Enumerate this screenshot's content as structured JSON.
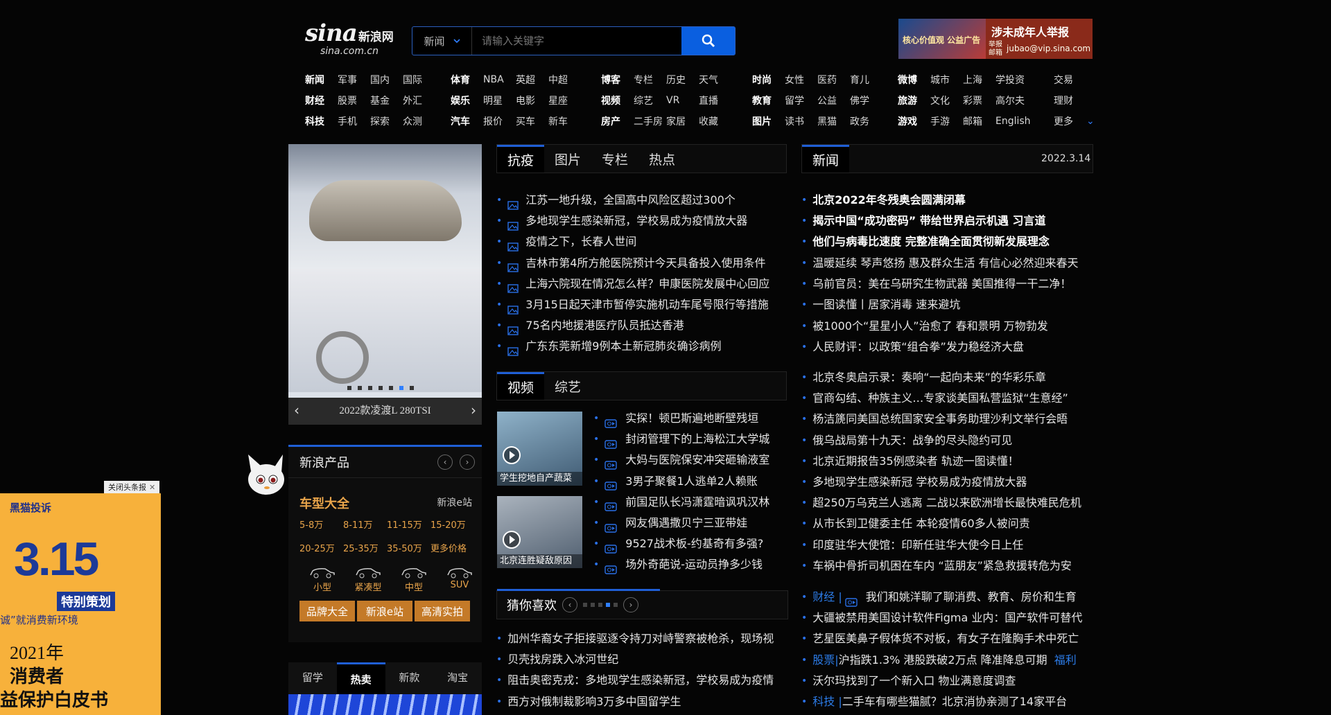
{
  "header": {
    "logo_text": "sina",
    "logo_cn": "新浪网",
    "logo_domain": "sina.com.cn",
    "search": {
      "category": "新闻",
      "placeholder": "请输入关键字"
    },
    "ad_left_text": "核心价值观 公益广告",
    "ad_right_title": "涉未成年人举报",
    "ad_right_side": "举报邮箱",
    "ad_right_email": "jubao@vip.sina.com"
  },
  "nav": {
    "groups": [
      {
        "rows": [
          [
            "新闻",
            "军事",
            "国内",
            "国际"
          ],
          [
            "财经",
            "股票",
            "基金",
            "外汇"
          ],
          [
            "科技",
            "手机",
            "探索",
            "众测"
          ]
        ]
      },
      {
        "rows": [
          [
            "体育",
            "NBA",
            "英超",
            "中超"
          ],
          [
            "娱乐",
            "明星",
            "电影",
            "星座"
          ],
          [
            "汽车",
            "报价",
            "买车",
            "新车"
          ]
        ]
      },
      {
        "rows": [
          [
            "博客",
            "专栏",
            "历史",
            "天气"
          ],
          [
            "视频",
            "综艺",
            "VR",
            "直播"
          ],
          [
            "房产",
            "二手房",
            "家居",
            "收藏"
          ]
        ]
      },
      {
        "rows": [
          [
            "时尚",
            "女性",
            "医药",
            "育儿"
          ],
          [
            "教育",
            "留学",
            "公益",
            "佛学"
          ],
          [
            "图片",
            "读书",
            "黑猫",
            "政务"
          ]
        ]
      },
      {
        "rows": [
          [
            "微博",
            "城市",
            "上海",
            "学投资"
          ],
          [
            "旅游",
            "文化",
            "彩票",
            "高尔夫"
          ],
          [
            "游戏",
            "手游",
            "邮箱",
            "English"
          ]
        ]
      },
      {
        "rows": [
          [
            "交易"
          ],
          [
            "理财"
          ],
          [
            "更多"
          ]
        ]
      }
    ]
  },
  "slider": {
    "caption": "2022款凌渡L 280TSI",
    "active_dot": 5
  },
  "products": {
    "title": "新浪产品",
    "car_title": "车型大全",
    "car_site": "新浪e站",
    "price_row1": [
      "5-8万",
      "8-11万",
      "11-15万",
      "15-20万"
    ],
    "price_row2": [
      "20-25万",
      "25-35万",
      "35-50万",
      "更多价格"
    ],
    "types": [
      "小型",
      "紧凑型",
      "中型",
      "SUV"
    ],
    "buttons": [
      "品牌大全",
      "新浪e站",
      "高清实拍"
    ]
  },
  "bottom_tabs": {
    "items": [
      "留学",
      "热卖",
      "新款",
      "淘宝"
    ],
    "active": 1
  },
  "left_ad": {
    "close_label": "关闭头条报",
    "brand": "黑猫投诉",
    "big": "3.15",
    "special": "特别策划",
    "line1": "诚”就消费新环境",
    "line2": "2021年",
    "line3": "消费者",
    "line4": "益保护白皮书"
  },
  "middle": {
    "tabs": [
      "抗疫",
      "图片",
      "专栏",
      "热点"
    ],
    "news": [
      "江苏一地升级，全国高中风险区超过300个",
      "多地现学生感染新冠，学校易成为疫情放大器",
      "疫情之下，长春人世间",
      "吉林市第4所方舱医院预计今天具备投入使用条件",
      "上海六院现在情况怎么样？申康医院发展中心回应",
      "3月15日起天津市暂停实施机动车尾号限行等措施",
      "75名内地援港医疗队员抵达香港",
      "广东东莞新增9例本土新冠肺炎确诊病例"
    ],
    "video_tabs": [
      "视频",
      "综艺"
    ],
    "video1_caption": "学生挖地自产蔬菜",
    "video2_caption": "北京连胜疑敌原因",
    "videos": [
      "实探！顿巴斯遍地断壁残垣",
      "封闭管理下的上海松江大学城",
      "大妈与医院保安冲突砸输液室",
      "3男子聚餐1人逃单2人赖账",
      "前国足队长冯潇霆暗讽巩汉林",
      "网友偶遇撒贝宁三亚带娃",
      "9527战术板-约基奇有多强?",
      "场外奇葩说-运动员挣多少钱"
    ],
    "guess_title": "猜你喜欢",
    "guess": [
      "加州华裔女子拒接驱逐令持刀对峙警察被枪杀，现场视",
      "贝壳找房跌入冰河世纪",
      "阻击奥密克戎：多地现学生感染新冠，学校易成为疫情",
      "西方对俄制裁影响3万多中国留学生"
    ]
  },
  "right": {
    "tab": "新闻",
    "date": "2022.3.14",
    "bold_news": [
      "北京2022年冬残奥会圆满闭幕",
      "揭示中国“成功密码” 带给世界启示机遇 习言道",
      "他们与病毒比速度 完整准确全面贯彻新发展理念"
    ],
    "news1": [
      "温暖延续 琴声悠扬 惠及群众生活 有信心必然迎来春天",
      "乌前官员：美在乌研究生物武器 美国推得一干二净！",
      "一图读懂丨居家消毒 速来避坑",
      "被1000个“星星小人”治愈了 春和景明 万物勃发",
      "人民财评：以政策“组合拳”发力稳经济大盘"
    ],
    "news2": [
      "北京冬奥启示录：奏响“一起向未来”的华彩乐章",
      "官商勾结、种族主义…专家谈美国私营监狱“生意经”",
      "杨洁篪同美国总统国家安全事务助理沙利文举行会晤",
      "俄乌战局第十九天：战争的尽头隐约可见",
      "北京近期报告35例感染者 轨迹一图读懂！",
      "多地现学生感染新冠 学校易成为疫情放大器",
      "超250万乌克兰人逃离 二战以来欧洲增长最快难民危机",
      "从市长到卫健委主任 本轮疫情60多人被问责",
      "印度驻华大使馆：印新任驻华大使今日上任",
      "车祸中骨折司机困在车内 “蓝朋友”紧急救援转危为安"
    ],
    "news3": [
      {
        "prefix": "财经 |",
        "text": "我们和姚洋聊了聊消费、教育、房价和生育",
        "icon": true
      },
      {
        "prefix": "",
        "text": "大疆被禁用美国设计软件Figma 业内：国产软件可替代"
      },
      {
        "prefix": "",
        "text": "艺星医美鼻子假体货不对板，有女子在隆胸手术中死亡"
      },
      {
        "prefix": "股票|",
        "text": "沪指跌1.3% 港股跌破2万点 降准降息可期",
        "suffix": "福利"
      },
      {
        "prefix": "",
        "text": "沃尔玛找到了一个新入口 物业满意度调查"
      },
      {
        "prefix": "科技 |",
        "text": "二手车有哪些猫腻？北京消协亲测了14家平台"
      }
    ]
  }
}
